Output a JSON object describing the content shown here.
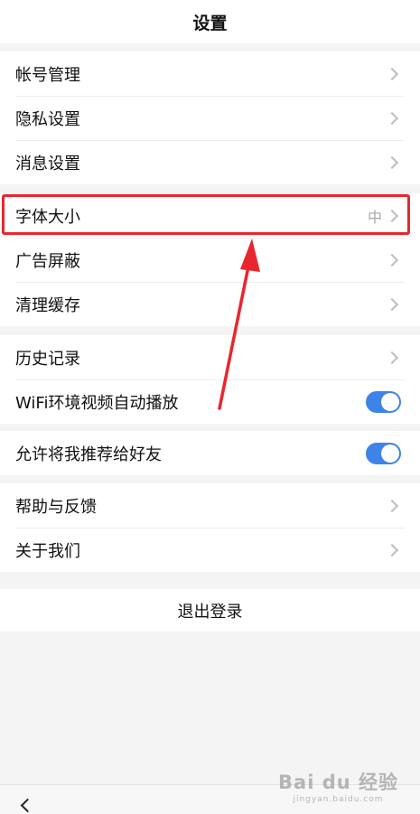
{
  "header": {
    "title": "设置"
  },
  "groups": [
    {
      "items": [
        {
          "label": "帐号管理"
        },
        {
          "label": "隐私设置"
        },
        {
          "label": "消息设置"
        }
      ]
    },
    {
      "items": [
        {
          "label": "字体大小",
          "value": "中"
        },
        {
          "label": "广告屏蔽"
        },
        {
          "label": "清理缓存"
        }
      ]
    },
    {
      "items": [
        {
          "label": "历史记录"
        },
        {
          "label": "WiFi环境视频自动播放",
          "toggle_on": true
        }
      ]
    },
    {
      "items": [
        {
          "label": "允许将我推荐给好友",
          "toggle_on": true
        }
      ]
    },
    {
      "items": [
        {
          "label": "帮助与反馈"
        },
        {
          "label": "关于我们"
        }
      ]
    }
  ],
  "logout": {
    "label": "退出登录"
  },
  "watermark": {
    "brand": "Bai du 经验",
    "url": "jingyan.baidu.com"
  },
  "colors": {
    "toggle_on": "#3d83e8",
    "annotation_red": "#e8262e"
  }
}
